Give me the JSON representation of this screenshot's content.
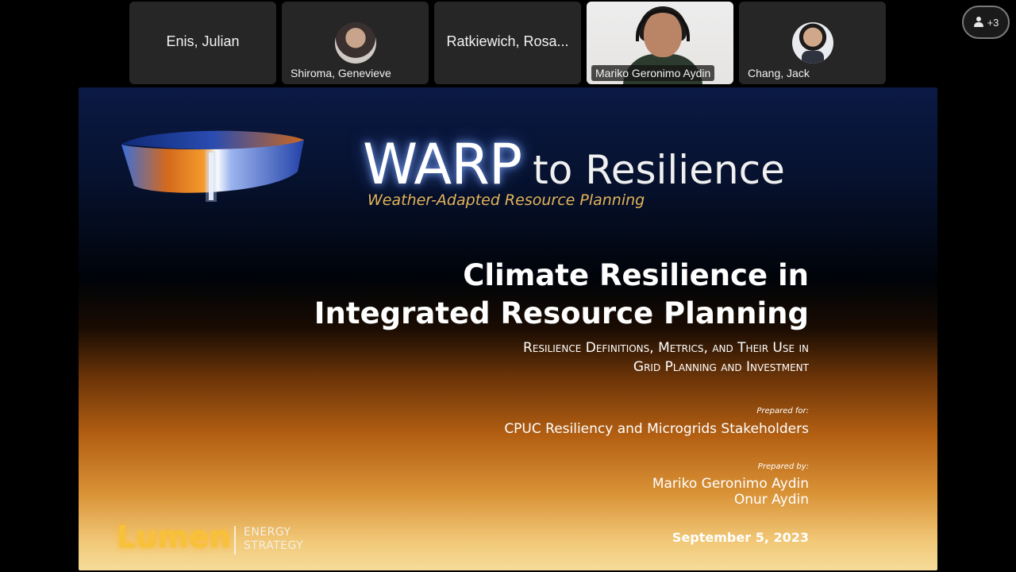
{
  "participants": [
    {
      "name": "Enis, Julian",
      "type": "name-only"
    },
    {
      "name": "Shiroma, Genevieve",
      "type": "avatar"
    },
    {
      "name": "Ratkiewich, Rosa...",
      "type": "name-only"
    },
    {
      "name": "Mariko Geronimo Aydin",
      "type": "video"
    },
    {
      "name": "Chang, Jack",
      "type": "avatar"
    }
  ],
  "overflow": {
    "count_label": "+3",
    "icon": "person-icon"
  },
  "slide": {
    "logo_title_main": "WARP",
    "logo_title_rest": "to Resilience",
    "logo_subtitle": "Weather-Adapted Resource Planning",
    "title_line1": "Climate Resilience in",
    "title_line2": "Integrated Resource Planning",
    "subtitle_line1": "Resilience Definitions, Metrics, and Their Use in",
    "subtitle_line2": "Grid Planning and Investment",
    "prepared_for_label": "Prepared for:",
    "prepared_for": "CPUC Resiliency and Microgrids Stakeholders",
    "prepared_by_label": "Prepared by:",
    "author1": "Mariko Geronimo Aydin",
    "author2": "Onur Aydin",
    "date": "September 5, 2023",
    "company_name": "Lumen",
    "company_sub1": "ENERGY",
    "company_sub2": "STRATEGY"
  },
  "colors": {
    "slide_top": "#0b1a44",
    "slide_bottom": "#f6dc9a",
    "subtitle_gold": "#e3b45c",
    "lumen_gold": "#f7c13a",
    "tile_bg": "#262626"
  }
}
